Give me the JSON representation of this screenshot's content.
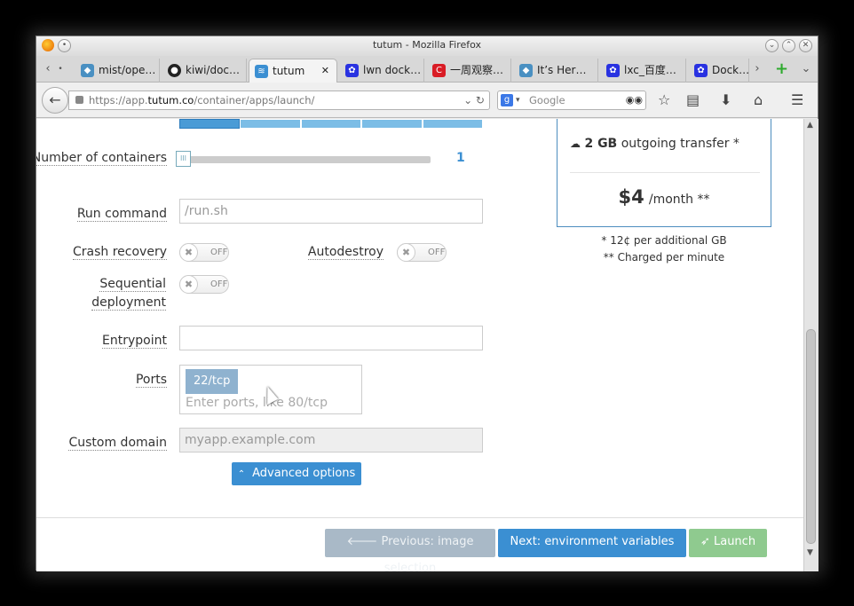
{
  "window": {
    "title": "tutum - Mozilla Firefox"
  },
  "tabs": [
    {
      "label": "mist/ope…",
      "icon": "docker-icon",
      "color": "#4a90c2"
    },
    {
      "label": "kiwi/doc…",
      "icon": "github-icon",
      "color": "#222222"
    },
    {
      "label": "tutum",
      "icon": "tutum-icon",
      "color": "#3b8fd2",
      "close": "✕"
    },
    {
      "label": "lwn dock…",
      "icon": "baidu-paw-icon",
      "color": "#2932e1"
    },
    {
      "label": "一周观察…",
      "icon": "c-icon",
      "color": "#d91c25"
    },
    {
      "label": "It’s Her…",
      "icon": "docker-icon",
      "color": "#4a90c2"
    },
    {
      "label": "lxc_百度…",
      "icon": "baidu-paw-icon",
      "color": "#2932e1"
    },
    {
      "label": "Dock…",
      "icon": "baidu-paw-icon",
      "color": "#2932e1"
    }
  ],
  "url": {
    "prefix": "https://app.",
    "domain": "tutum.co",
    "path": "/container/apps/launch/"
  },
  "search": {
    "placeholder": "Google"
  },
  "form": {
    "containers_label": "Number of containers",
    "containers_value": "1",
    "run_command_label": "Run command",
    "run_command_placeholder": "/run.sh",
    "crash_label": "Crash recovery",
    "autodestroy_label": "Autodestroy",
    "sequential_label": "Sequential deployment",
    "toggle_off": "OFF",
    "entrypoint_label": "Entrypoint",
    "entrypoint_value": "",
    "ports_label": "Ports",
    "port_tag": "22/tcp",
    "ports_placeholder": "Enter ports, like 80/tcp",
    "domain_label": "Custom domain",
    "domain_placeholder": "myapp.example.com",
    "advanced": "Advanced options"
  },
  "pricing": {
    "transfer_amount": "2 GB",
    "transfer_text": "outgoing transfer *",
    "price": "$4",
    "per": "/month **",
    "note1": "* 12¢ per additional GB",
    "note2": "** Charged per minute"
  },
  "buttons": {
    "prev": "Previous: image selection",
    "next": "Next: environment variables",
    "launch": "Launch"
  },
  "colors": {
    "primary": "#3b8fd2",
    "success": "#8fca8f",
    "disabled": "#a9b9c7"
  }
}
